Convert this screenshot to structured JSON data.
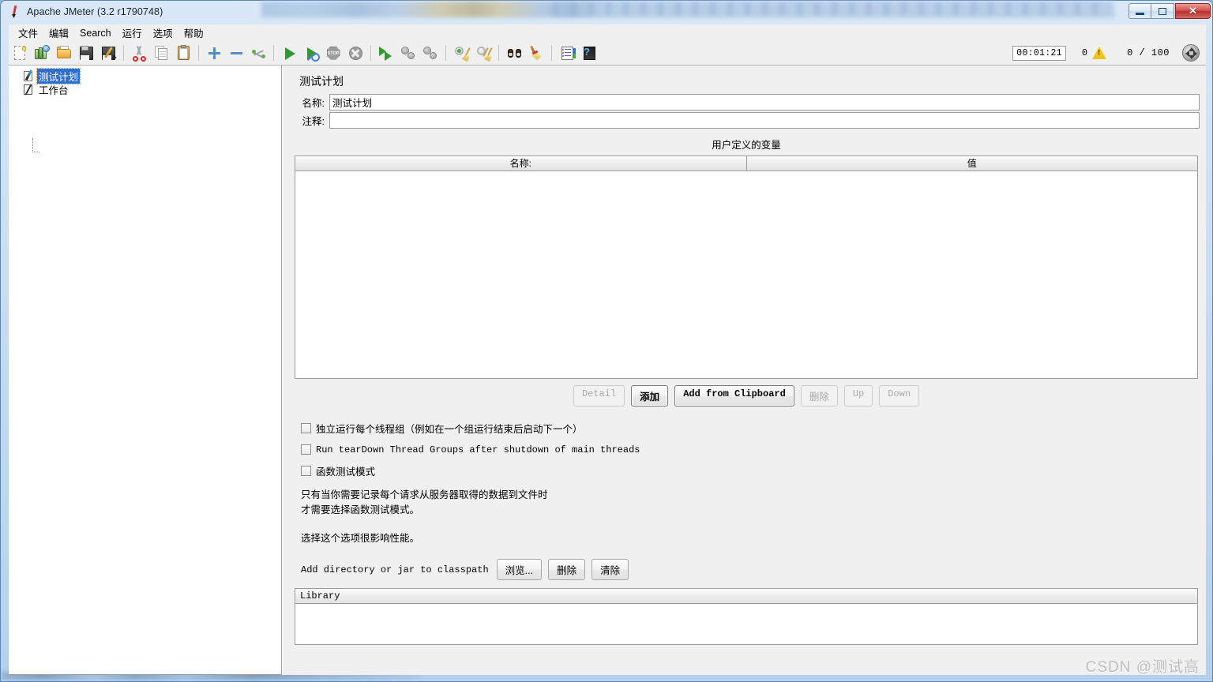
{
  "window": {
    "title": "Apache JMeter (3.2 r1790748)",
    "app_icon": "jmeter-feather-icon",
    "controls": {
      "minimize": "minimize-button",
      "restore": "restore-button",
      "close_label": "✕"
    }
  },
  "menu": {
    "items": [
      {
        "label": "文件",
        "name": "menu-file"
      },
      {
        "label": "编辑",
        "name": "menu-edit"
      },
      {
        "label": "Search",
        "name": "menu-search"
      },
      {
        "label": "运行",
        "name": "menu-run"
      },
      {
        "label": "选项",
        "name": "menu-options"
      },
      {
        "label": "帮助",
        "name": "menu-help"
      }
    ]
  },
  "toolbar": {
    "icons": [
      "new-icon",
      "templates-icon",
      "open-icon",
      "save-icon",
      "save-as-icon",
      "cut-icon",
      "copy-icon",
      "paste-icon",
      "expand-all-icon",
      "collapse-all-icon",
      "toggle-icon",
      "start-icon",
      "start-no-timers-icon",
      "stop-icon",
      "shutdown-icon",
      "remote-start-all-icon",
      "remote-stop-all-icon",
      "remote-shutdown-all-icon",
      "clear-icon",
      "clear-all-icon",
      "search-icon",
      "search-reset-icon",
      "function-helper-icon",
      "help-icon"
    ],
    "status": {
      "timer": "00:01:21",
      "warning_count": "0",
      "warning_icon": "warning-triangle-icon",
      "threads": "0 / 100",
      "expand_icon": "expand-collapse-icon"
    }
  },
  "tree": {
    "root": {
      "label": "测试计划",
      "icon": "test-plan-icon",
      "selected": true
    },
    "child": {
      "label": "工作台",
      "icon": "workbench-icon",
      "selected": false
    }
  },
  "main": {
    "title": "测试计划",
    "fields": {
      "name_label": "名称:",
      "name_value": "测试计划",
      "comment_label": "注释:",
      "comment_value": ""
    },
    "udv": {
      "title": "用户定义的变量",
      "columns": [
        "名称:",
        "值"
      ],
      "rows": []
    },
    "udv_buttons": [
      {
        "label": "Detail",
        "name": "detail-button",
        "disabled": true,
        "mono": true,
        "default": false
      },
      {
        "label": "添加",
        "name": "add-button",
        "disabled": false,
        "mono": false,
        "default": true
      },
      {
        "label": "Add from Clipboard",
        "name": "add-from-clipboard-button",
        "disabled": false,
        "mono": true,
        "default": true
      },
      {
        "label": "删除",
        "name": "delete-button",
        "disabled": true,
        "mono": false,
        "default": false
      },
      {
        "label": "Up",
        "name": "up-button",
        "disabled": true,
        "mono": true,
        "default": false
      },
      {
        "label": "Down",
        "name": "down-button",
        "disabled": true,
        "mono": true,
        "default": false
      }
    ],
    "checkboxes": [
      {
        "label": "独立运行每个线程组（例如在一个组运行结束后启动下一个）",
        "name": "serialize-thread-groups-checkbox",
        "checked": false,
        "mono": false
      },
      {
        "label": "Run tearDown Thread Groups after shutdown of main threads",
        "name": "run-teardown-checkbox",
        "checked": false,
        "mono": true
      },
      {
        "label": "函数测试模式",
        "name": "functional-test-mode-checkbox",
        "checked": false,
        "mono": false
      }
    ],
    "notes": [
      "只有当你需要记录每个请求从服务器取得的数据到文件时",
      "才需要选择函数测试模式。",
      "",
      "选择这个选项很影响性能。"
    ],
    "classpath": {
      "label": "Add directory or jar to classpath",
      "buttons": [
        {
          "label": "浏览...",
          "name": "browse-button"
        },
        {
          "label": "删除",
          "name": "classpath-delete-button"
        },
        {
          "label": "清除",
          "name": "classpath-clear-button"
        }
      ]
    },
    "library": {
      "column": "Library",
      "rows": []
    }
  },
  "watermark": "CSDN @测试高"
}
